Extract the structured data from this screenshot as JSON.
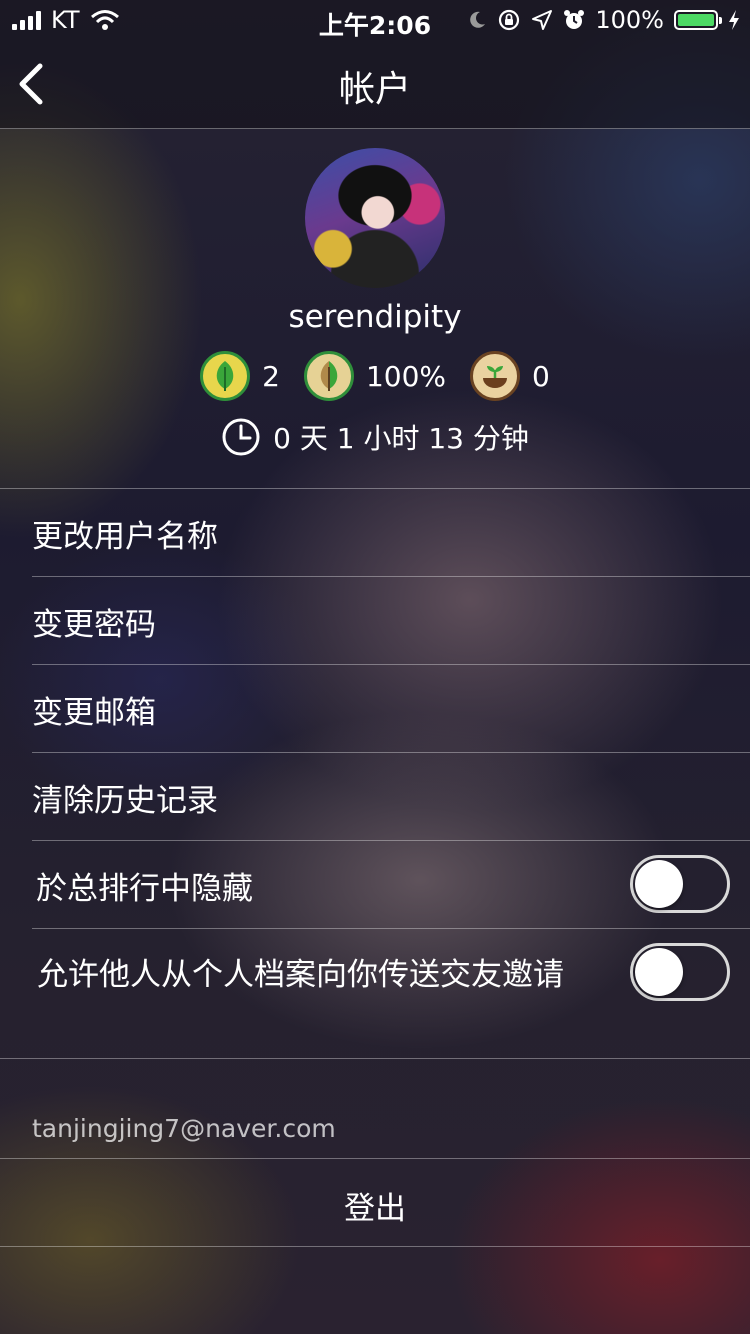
{
  "status_bar": {
    "carrier": "KT",
    "time": "上午2:06",
    "battery": "100%",
    "icons": [
      "signal-icon",
      "wifi-icon",
      "moon-icon",
      "rotation-lock-icon",
      "location-icon",
      "alarm-icon",
      "battery-icon",
      "charging-icon"
    ]
  },
  "nav": {
    "title": "帐户",
    "back_icon": "chevron-left-icon"
  },
  "profile": {
    "username": "serendipity",
    "stats": [
      {
        "icon": "green-leaf-icon",
        "value": "2"
      },
      {
        "icon": "half-leaf-icon",
        "value": "100%"
      },
      {
        "icon": "sprout-icon",
        "value": "0"
      }
    ],
    "time_icon": "clock-icon",
    "time_focused": "0 天 1 小时 13 分钟"
  },
  "menu": {
    "change_username": "更改用户名称",
    "change_password": "变更密码",
    "change_email": "变更邮箱",
    "clear_history": "清除历史记录",
    "hide_ranking": {
      "label": "於总排行中隐藏",
      "on": false
    },
    "allow_friend_invites": {
      "label": "允许他人从个人档案向你传送交友邀请",
      "on": false
    }
  },
  "account": {
    "email": "tanjingjing7@naver.com",
    "logout": "登出"
  },
  "colors": {
    "battery": "#4cd964",
    "leaf_green": "#3aa63a",
    "toggle_off_border": "#d9d9d9"
  }
}
